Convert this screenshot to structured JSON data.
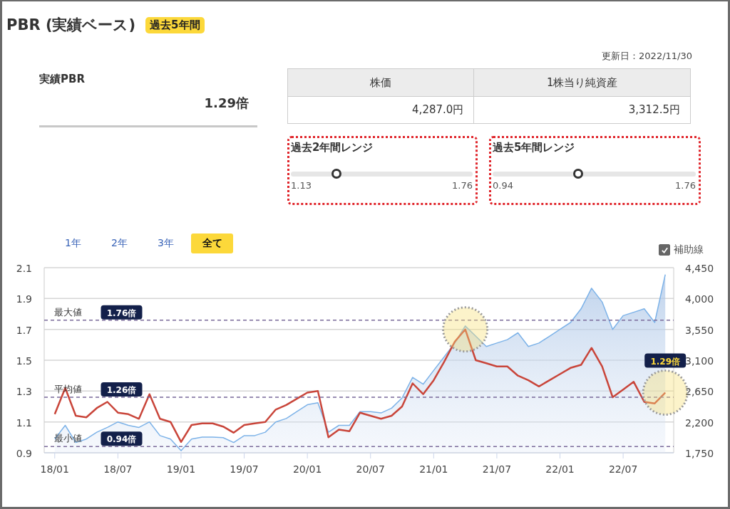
{
  "title": "PBR (実績ベース)",
  "title_badge": "過去5年間",
  "updated": "更新日：2022/11/30",
  "current": {
    "label": "実績PBR",
    "value": "1.29倍"
  },
  "table": {
    "columns": [
      "株価",
      "1株当り純資産"
    ],
    "values": [
      "4,287.0円",
      "3,312.5円"
    ]
  },
  "ranges": [
    {
      "title": "過去2年間レンジ",
      "min": "1.13",
      "max": "1.76",
      "level": 0.25
    },
    {
      "title": "過去5年間レンジ",
      "min": "0.94",
      "max": "1.76",
      "level": 0.42
    }
  ],
  "period_tabs": [
    {
      "label": "1年",
      "selected": false
    },
    {
      "label": "2年",
      "selected": false
    },
    {
      "label": "3年",
      "selected": false
    },
    {
      "label": "全て",
      "selected": true
    }
  ],
  "aux_lines": {
    "label": "補助線",
    "checked": true
  },
  "chart_data": {
    "type": "line",
    "categories": [
      "18/01",
      null,
      null,
      null,
      null,
      null,
      "18/07",
      null,
      null,
      null,
      null,
      null,
      "19/01",
      null,
      null,
      null,
      null,
      null,
      "19/07",
      null,
      null,
      null,
      null,
      null,
      "20/01",
      null,
      null,
      null,
      null,
      null,
      "20/07",
      null,
      null,
      null,
      null,
      null,
      "21/01",
      null,
      null,
      null,
      null,
      null,
      "21/07",
      null,
      null,
      null,
      null,
      null,
      "22/01",
      null,
      null,
      null,
      null,
      null,
      "22/07",
      null,
      null,
      null,
      null
    ],
    "series": [
      {
        "axis": "y2",
        "type": "area",
        "color": "#7cb2e8",
        "values": [
          1950,
          2150,
          1900,
          1950,
          2050,
          2120,
          2200,
          2150,
          2120,
          2200,
          2000,
          1950,
          1780,
          1950,
          1980,
          1980,
          1970,
          1900,
          2000,
          2000,
          2050,
          2200,
          2250,
          2350,
          2450,
          2480,
          2050,
          2150,
          2150,
          2350,
          2350,
          2330,
          2400,
          2550,
          2850,
          2750,
          2950,
          3150,
          3350,
          3600,
          3450,
          3300,
          3350,
          3400,
          3500,
          3300,
          3350,
          3450,
          3550,
          3650,
          3850,
          4150,
          3950,
          3550,
          3750,
          3800,
          3850,
          3650,
          4350
        ]
      },
      {
        "type": "line",
        "color": "#c9453a",
        "values": [
          1.15,
          1.32,
          1.14,
          1.13,
          1.19,
          1.23,
          1.16,
          1.15,
          1.12,
          1.28,
          1.12,
          1.1,
          0.97,
          1.08,
          1.09,
          1.09,
          1.07,
          1.03,
          1.08,
          1.09,
          1.1,
          1.18,
          1.21,
          1.25,
          1.29,
          1.3,
          1.0,
          1.05,
          1.04,
          1.16,
          1.14,
          1.12,
          1.14,
          1.2,
          1.35,
          1.28,
          1.37,
          1.49,
          1.62,
          1.7,
          1.5,
          1.48,
          1.46,
          1.46,
          1.4,
          1.37,
          1.33,
          1.37,
          1.41,
          1.45,
          1.47,
          1.58,
          1.46,
          1.26,
          1.31,
          1.36,
          1.23,
          1.22,
          1.29
        ]
      }
    ],
    "ylim": [
      0.9,
      2.1
    ],
    "yticks": [
      0.9,
      1.1,
      1.3,
      1.5,
      1.7,
      1.9,
      2.1
    ],
    "y2lim": [
      1750,
      4450
    ],
    "y2ticks": [
      {
        "value": 1750,
        "label": "1,750"
      },
      {
        "value": 2200,
        "label": "2,200"
      },
      {
        "value": 2650,
        "label": "2,650"
      },
      {
        "value": 3100,
        "label": "3,100"
      },
      {
        "value": 3550,
        "label": "3,550"
      },
      {
        "value": 4000,
        "label": "4,000"
      },
      {
        "value": 4450,
        "label": "4,450"
      }
    ],
    "grid": true,
    "ref_lines": [
      {
        "axis": "y",
        "value": 1.76,
        "label": "最大値"
      },
      {
        "axis": "y",
        "value": 1.26,
        "label": "平均値"
      },
      {
        "axis": "y",
        "value": 0.94,
        "label": "最小値"
      }
    ],
    "annotations": [
      "1.76倍",
      "1.26倍",
      "0.94倍",
      "1.29倍"
    ]
  }
}
